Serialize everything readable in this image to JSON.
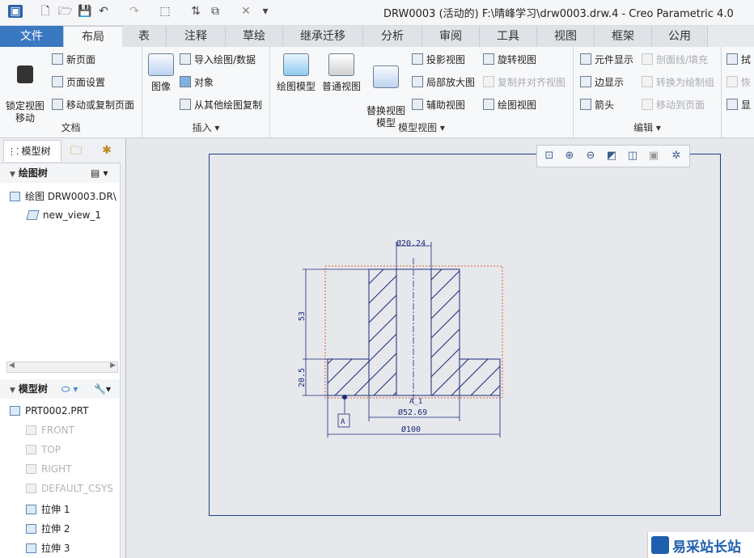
{
  "window": {
    "title": "DRW0003 (活动的) F:\\晴峰学习\\drw0003.drw.4 - Creo Parametric 4.0"
  },
  "tabs": [
    "文件",
    "布局",
    "表",
    "注释",
    "草绘",
    "继承迁移",
    "分析",
    "审阅",
    "工具",
    "视图",
    "框架",
    "公用"
  ],
  "ribbon": {
    "doc": {
      "lock_view": "锁定视图\n移动",
      "new_page": "新页面",
      "page_setup": "页面设置",
      "move_copy_page": "移动或复制页面",
      "label": "文档"
    },
    "insert": {
      "image": "图像",
      "import": "导入绘图/数据",
      "object": "对象",
      "copy_from": "从其他绘图复制",
      "label": "插入"
    },
    "model_views": {
      "drawing_model": "绘图模型",
      "general_view": "普通视图",
      "replace_view": "替换视图\n模型",
      "projection": "投影视图",
      "detail": "局部放大图",
      "auxiliary": "辅助视图",
      "revolved": "旋转视图",
      "copy_align": "复制并对齐视图",
      "drawing_view": "绘图视图",
      "label": "模型视图"
    },
    "edit": {
      "element_display": "元件显示",
      "edge_display": "边显示",
      "arrow": "箭头",
      "section_fill": "剖面线/填充",
      "convert_group": "转换为绘制组",
      "move_to_page": "移动到页面",
      "label": "编辑"
    },
    "more": {
      "a": "拭",
      "b": "恢",
      "c": "显"
    }
  },
  "left_panel": {
    "tabs": {
      "model_tree": "模型树"
    },
    "drawing_tree": {
      "title": "绘图树",
      "items": [
        "绘图 DRW0003.DR\\",
        "new_view_1"
      ]
    },
    "model_tree": {
      "title": "模型树",
      "items": [
        "PRT0002.PRT",
        "FRONT",
        "TOP",
        "RIGHT",
        "DEFAULT_CSYS",
        "拉伸 1",
        "拉伸 2",
        "拉伸 3"
      ]
    }
  },
  "drawing": {
    "dims": {
      "top_dia": "Ø20.24",
      "mid_dia": "Ø52.69",
      "bottom_dia": "Ø100",
      "height": "53",
      "flange": "20.5",
      "datum": "A",
      "datum_label": "A_1"
    }
  },
  "watermark": {
    "text": "易采站长站"
  }
}
